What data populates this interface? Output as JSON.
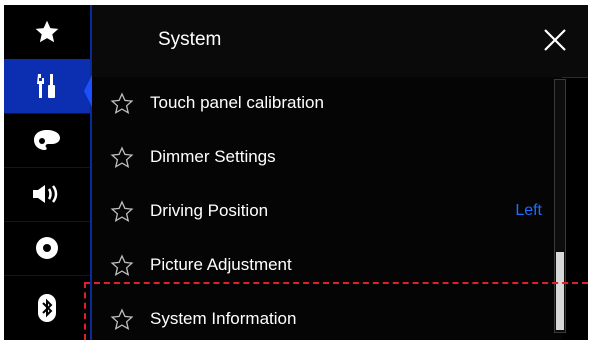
{
  "header": {
    "title": "System"
  },
  "sidebar": {
    "items": [
      {
        "icon": "star-icon",
        "active": false
      },
      {
        "icon": "settings-tools-icon",
        "active": true
      },
      {
        "icon": "theme-palette-icon",
        "active": false
      },
      {
        "icon": "speaker-icon",
        "active": false
      },
      {
        "icon": "disc-icon",
        "active": false
      },
      {
        "icon": "bluetooth-icon",
        "active": false
      }
    ]
  },
  "list": {
    "items": [
      {
        "label": "Touch panel calibration",
        "value": ""
      },
      {
        "label": "Dimmer Settings",
        "value": ""
      },
      {
        "label": "Driving Position",
        "value": "Left"
      },
      {
        "label": "Picture Adjustment",
        "value": ""
      },
      {
        "label": "System Information",
        "value": ""
      }
    ]
  },
  "colors": {
    "active_tab": "#0b2fb0",
    "value_text": "#1e6cff",
    "highlight_dash": "#e01f2b"
  }
}
